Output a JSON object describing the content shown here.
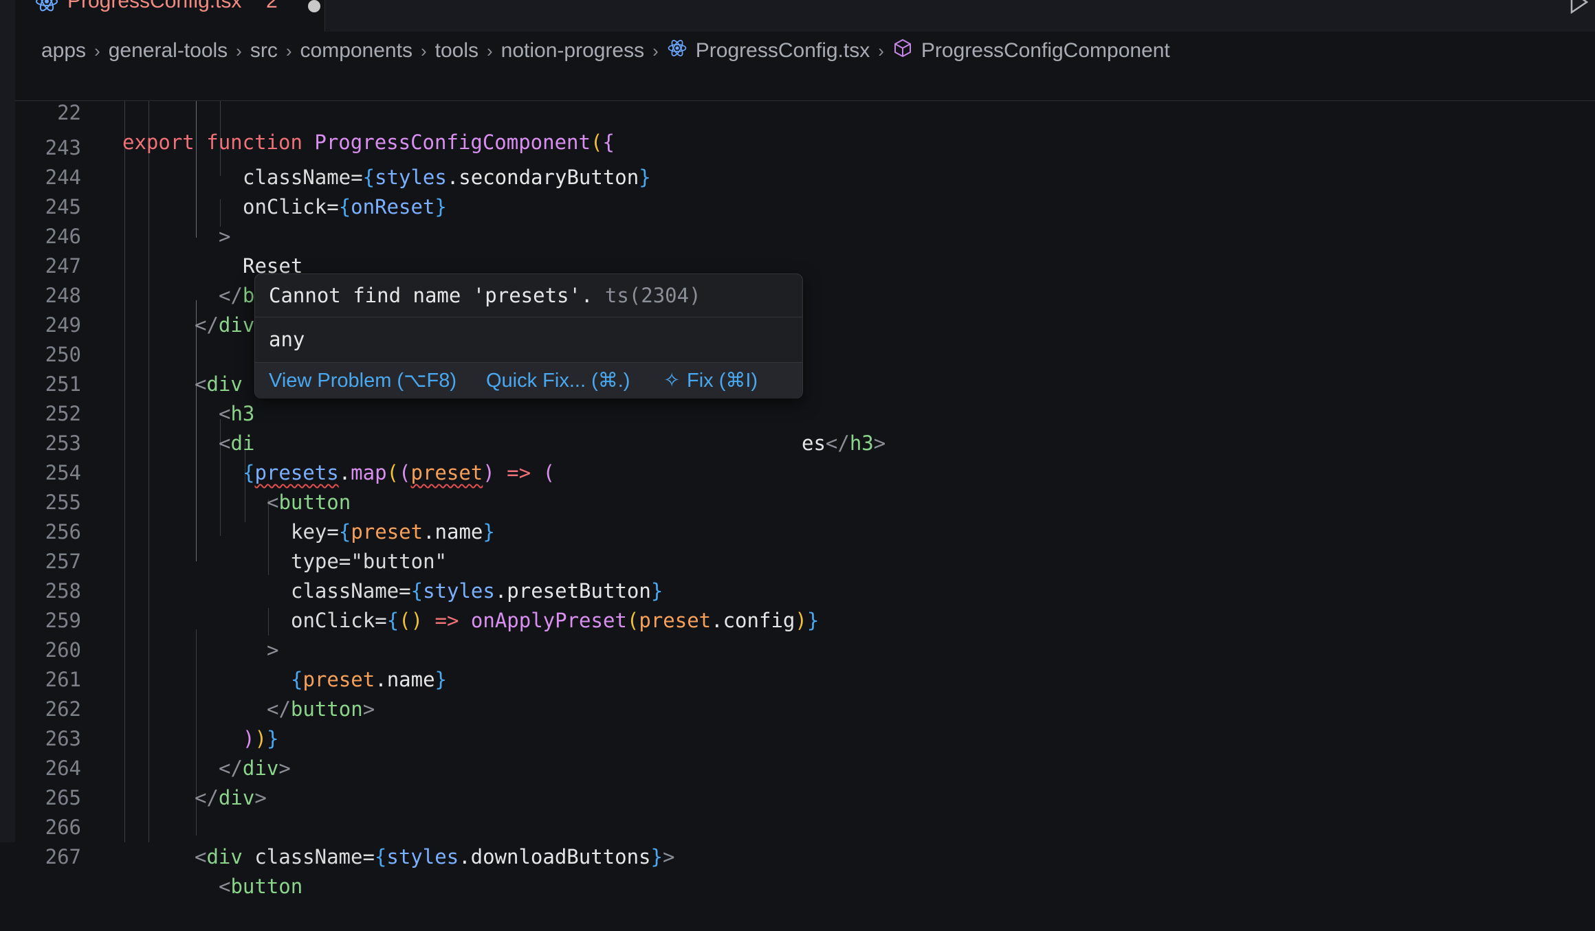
{
  "tab": {
    "label": "ProgressConfig.tsx",
    "problem_count": "2",
    "icon": "react-icon",
    "accent_color": "#f28b82"
  },
  "breadcrumb": {
    "items": [
      "apps",
      "general-tools",
      "src",
      "components",
      "tools",
      "notion-progress",
      "ProgressConfig.tsx",
      "ProgressConfigComponent"
    ]
  },
  "sticky_scroll": {
    "line_number": "22",
    "kw_export": "export",
    "kw_function": "function",
    "fn_name": "ProgressConfigComponent",
    "paren_open": "(",
    "brace_open": "{"
  },
  "lines": [
    {
      "n": "243",
      "t": [
        "className=",
        "{",
        "styles",
        ".secondaryButton",
        "}"
      ]
    },
    {
      "n": "244",
      "t": [
        "onClick=",
        "{",
        "onReset",
        "}"
      ]
    },
    {
      "n": "245",
      "t": [
        ">"
      ]
    },
    {
      "n": "246",
      "t": [
        "Reset"
      ]
    },
    {
      "n": "247",
      "t": [
        "</",
        "button",
        ">"
      ]
    },
    {
      "n": "248",
      "t": [
        "</",
        "div",
        ">"
      ]
    },
    {
      "n": "249",
      "t": []
    },
    {
      "n": "250",
      "t": [
        "<",
        "div"
      ]
    },
    {
      "n": "251",
      "t": [
        "<",
        "h3",
        "es",
        "</",
        "h3",
        ">"
      ]
    },
    {
      "n": "252",
      "t": [
        "<",
        "di"
      ]
    },
    {
      "n": "253",
      "t": [
        "{",
        "presets",
        ".",
        "map",
        "(",
        "(",
        "preset",
        ")",
        " => ",
        "("
      ]
    },
    {
      "n": "254",
      "t": [
        "<",
        "button"
      ]
    },
    {
      "n": "255",
      "t": [
        "key=",
        "{",
        "preset",
        ".name",
        "}"
      ]
    },
    {
      "n": "256",
      "t": [
        "type=",
        "\"button\""
      ]
    },
    {
      "n": "257",
      "t": [
        "className=",
        "{",
        "styles",
        ".presetButton",
        "}"
      ]
    },
    {
      "n": "258",
      "t": [
        "onClick=",
        "{",
        "()",
        " => ",
        "onApplyPreset",
        "(",
        "preset",
        ".config",
        ")",
        "}"
      ]
    },
    {
      "n": "259",
      "t": [
        ">"
      ]
    },
    {
      "n": "260",
      "t": [
        "{",
        "preset",
        ".name",
        "}"
      ]
    },
    {
      "n": "261",
      "t": [
        "</",
        "button",
        ">"
      ]
    },
    {
      "n": "262",
      "t": [
        ")",
        ")",
        "}"
      ]
    },
    {
      "n": "263",
      "t": [
        "</",
        "div",
        ">"
      ]
    },
    {
      "n": "264",
      "t": [
        "</",
        "div",
        ">"
      ]
    },
    {
      "n": "265",
      "t": []
    },
    {
      "n": "266",
      "t": [
        "<",
        "div",
        " className=",
        "{",
        "styles",
        ".downloadButtons",
        "}",
        ">"
      ]
    },
    {
      "n": "267",
      "t": [
        "<",
        "button"
      ]
    }
  ],
  "hover": {
    "message": "Cannot find name 'presets'.",
    "code": "ts(2304)",
    "type": "any",
    "actions": {
      "view_problem": "View Problem (⌥F8)",
      "quick_fix": "Quick Fix... (⌘.)",
      "fix": "Fix (⌘I)"
    }
  },
  "colors": {
    "background": "#121316",
    "keyword": "#f07178",
    "function": "#d98ff0",
    "tag": "#8bd48b",
    "brace": "#4aa8f0",
    "parameter": "#f7a05a",
    "link": "#4aa8f0",
    "error": "#e05050"
  }
}
